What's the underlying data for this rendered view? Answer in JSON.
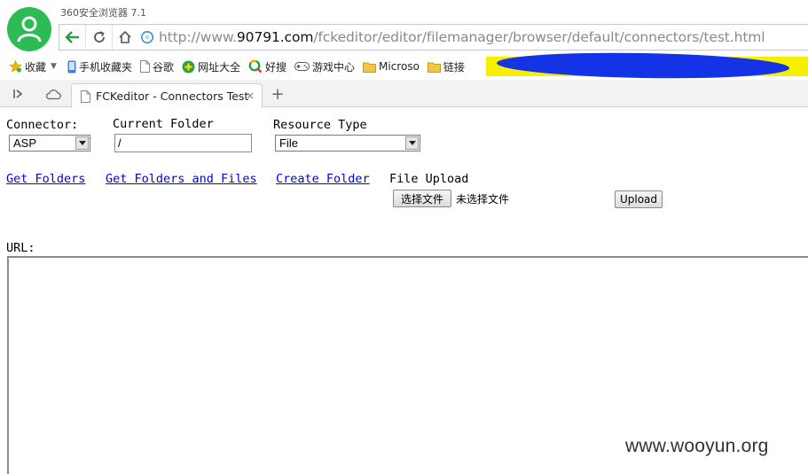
{
  "browser": {
    "app_title": "360安全浏览器 7.1",
    "address": {
      "prefix": "http://www.",
      "domain": "90791.com",
      "path": "/fckeditor/editor/filemanager/browser/default/connectors/test.html"
    },
    "bookmarks": [
      {
        "label": "收藏",
        "icon": "star-icon"
      },
      {
        "label": "手机收藏夹",
        "icon": "phone-icon"
      },
      {
        "label": "谷歌",
        "icon": "page-icon"
      },
      {
        "label": "网址大全",
        "icon": "plus-circle-icon"
      },
      {
        "label": "好搜",
        "icon": "search-q-icon"
      },
      {
        "label": "游戏中心",
        "icon": "gamepad-icon"
      },
      {
        "label": "Microso",
        "icon": "folder-icon"
      },
      {
        "label": "链接",
        "icon": "folder-icon"
      }
    ],
    "tab": {
      "title": "FCKeditor - Connectors Test",
      "close": "×"
    },
    "new_tab": "+"
  },
  "form": {
    "connector_label": "Connector:",
    "connector_value": "ASP",
    "current_folder_label": "Current Folder",
    "current_folder_value": "/",
    "resource_type_label": "Resource Type",
    "resource_type_value": "File",
    "links": {
      "get_folders": "Get Folders",
      "get_folders_files": "Get Folders and Files",
      "create_folder": "Create Folder"
    },
    "file_upload_label": "File Upload",
    "choose_file_button": "选择文件",
    "no_file_text": "未选择文件",
    "upload_button": "Upload",
    "url_label": "URL:"
  },
  "watermark": "www.wooyun.org",
  "colors": {
    "link": "#0000ee",
    "avatar": "#2dbb56",
    "back_arrow": "#2a9a3c",
    "redaction_yellow": "#f6f000",
    "redaction_blue": "#1433e6"
  }
}
